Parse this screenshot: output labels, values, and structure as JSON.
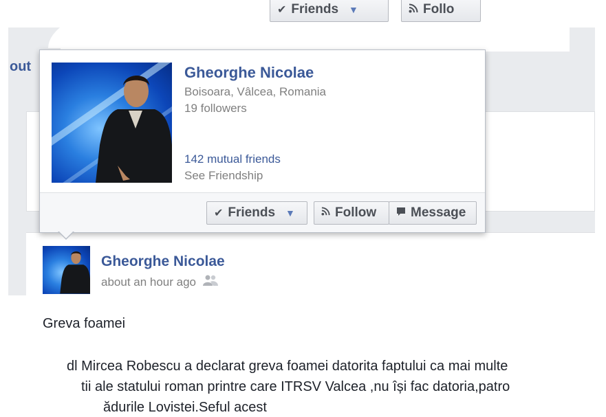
{
  "top_buttons": {
    "friends_label": "Friends",
    "follow_label": "Follo"
  },
  "side_partial_text": "out",
  "hovercard": {
    "name": "Gheorghe Nicolae",
    "location": "Boisoara, Vâlcea, Romania",
    "followers": "19 followers",
    "mutual_friends": "142 mutual friends",
    "see_friendship": "See Friendship",
    "buttons": {
      "friends": "Friends",
      "follow": "Follow",
      "message": "Message"
    }
  },
  "post": {
    "author": "Gheorghe Nicolae",
    "time": "about an hour ago",
    "title": "Greva foamei",
    "body_line1": "dl Mircea Robescu a declarat greva foamei datorita faptului ca mai multe",
    "body_line2": "tii ale statului roman printre care ITRSV Valcea ,nu își fac datoria,patro",
    "body_line3": "ădurile Lovistei.Seful acest"
  },
  "icons": {
    "check": "check-icon",
    "caret": "caret-down-icon",
    "rss": "rss-icon",
    "message": "message-bubble-icon",
    "audience": "friends-audience-icon"
  },
  "colors": {
    "link": "#3b5998",
    "muted": "#7f7f7f",
    "button_bg": "#f6f7f9"
  }
}
